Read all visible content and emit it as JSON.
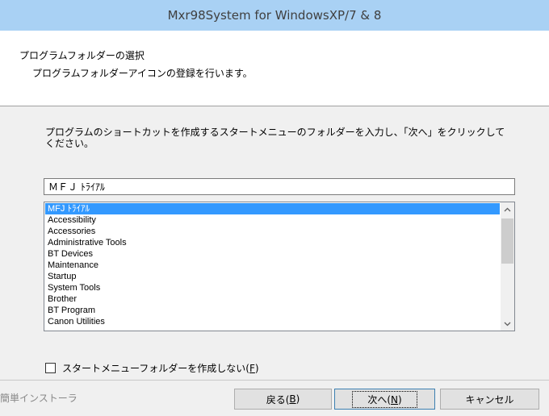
{
  "window": {
    "title": "Mxr98System for WindowsXP/7 & 8"
  },
  "header": {
    "title": "プログラムフォルダーの選択",
    "subtitle": "プログラムフォルダーアイコンの登録を行います。"
  },
  "main": {
    "instruction": "プログラムのショートカットを作成するスタートメニューのフォルダーを入力し、「次へ」をクリックしてください。",
    "folder_input_value": "ＭＦＪ ﾄﾗｲｱﾙ",
    "folder_list": [
      "MFJ ﾄﾗｲｱﾙ",
      "Accessibility",
      "Accessories",
      "Administrative Tools",
      "BT Devices",
      "Maintenance",
      "Startup",
      "System Tools",
      "Brother",
      "BT Program",
      "Canon Utilities"
    ],
    "selected_index": 0,
    "checkbox_label": "スタートメニューフォルダーを作成しない(",
    "checkbox_mnemonic": "F",
    "checkbox_label_end": ")",
    "checkbox_checked": false
  },
  "footer": {
    "installer_label": "簡単インストーラ",
    "back_label": "戻る(",
    "back_mnemonic": "B",
    "next_label": "次へ(",
    "next_mnemonic": "N",
    "mnemonic_close": ")",
    "cancel_label": "キャンセル"
  },
  "colors": {
    "titlebar": "#a9d1f4",
    "selection": "#3399ff"
  }
}
